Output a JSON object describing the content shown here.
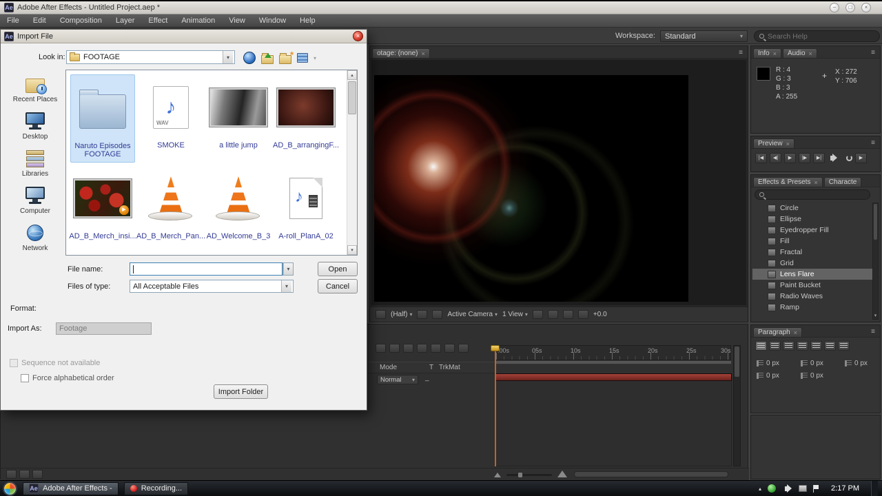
{
  "icons": {
    "close": "×",
    "dropdown": "▾",
    "up_arrow": "▴",
    "down_arrow": "▾",
    "menu": "≡",
    "minimize": "–",
    "maximize": "□",
    "first_frame": "|◀",
    "prev_frame": "◀|",
    "play": "▶",
    "next_frame": "|▶",
    "last_frame": "▶|",
    "crosshair": "+"
  },
  "titlebar": {
    "app_icon": "Ae",
    "title": "Adobe After Effects - Untitled Project.aep *"
  },
  "menubar": {
    "items": [
      "File",
      "Edit",
      "Composition",
      "Layer",
      "Effect",
      "Animation",
      "View",
      "Window",
      "Help"
    ]
  },
  "toolbar": {
    "workspace_label": "Workspace:",
    "workspace_value": "Standard",
    "search_placeholder": "Search Help"
  },
  "dialog": {
    "app_icon": "Ae",
    "title": "Import File",
    "look_in_label": "Look in:",
    "look_in_value": "FOOTAGE",
    "places": [
      {
        "label": "Recent Places"
      },
      {
        "label": "Desktop"
      },
      {
        "label": "Libraries"
      },
      {
        "label": "Computer"
      },
      {
        "label": "Network"
      }
    ],
    "files": [
      {
        "name": "Naruto Episodes FOOTAGE"
      },
      {
        "name": "SMOKE"
      },
      {
        "name": "a little jump"
      },
      {
        "name": "AD_B_arrangingF..."
      },
      {
        "name": "AD_B_Merch_insi..."
      },
      {
        "name": "AD_B_Merch_Pan..."
      },
      {
        "name": "AD_Welcome_B_3"
      },
      {
        "name": "A-roll_PlanA_02"
      }
    ],
    "wav_label": "WAV",
    "file_name_label": "File name:",
    "file_name_value": "",
    "files_of_type_label": "Files of type:",
    "files_of_type_value": "All Acceptable Files",
    "open_button": "Open",
    "cancel_button": "Cancel",
    "format_label": "Format:",
    "import_as_label": "Import As:",
    "import_as_value": "Footage",
    "sequence_checkbox_label": "Sequence not available",
    "alphabetical_checkbox_label": "Force alphabetical order",
    "import_folder_button": "Import Folder"
  },
  "comp": {
    "tab": "otage: (none)",
    "magnification": "(Half)",
    "camera": "Active Camera",
    "view_layout": "1 View",
    "exposure": "+0.0"
  },
  "info": {
    "tab_info": "Info",
    "tab_audio": "Audio",
    "r": "R : 4",
    "g": "G : 3",
    "b": "B : 3",
    "a": "A : 255",
    "x": "X : 272",
    "y": "Y : 706"
  },
  "preview": {
    "tab": "Preview"
  },
  "effects": {
    "tab": "Effects & Presets",
    "tab2": "Characte",
    "items": [
      {
        "label": "Circle"
      },
      {
        "label": "Ellipse"
      },
      {
        "label": "Eyedropper Fill"
      },
      {
        "label": "Fill"
      },
      {
        "label": "Fractal"
      },
      {
        "label": "Grid"
      },
      {
        "label": "Lens Flare"
      },
      {
        "label": "Paint Bucket"
      },
      {
        "label": "Radio Waves"
      },
      {
        "label": "Ramp"
      }
    ]
  },
  "paragraph": {
    "tab": "Paragraph",
    "fields": [
      {
        "value": "0 px"
      },
      {
        "value": "0 px"
      },
      {
        "value": "0 px"
      },
      {
        "value": "0 px"
      },
      {
        "value": "0 px"
      }
    ]
  },
  "timeline": {
    "mode_header": "Mode",
    "t_header": "T",
    "trkmat_header": "TrkMat",
    "blend_mode": "Normal",
    "trkmat_value": "_",
    "ruler": [
      ":00s",
      "05s",
      "10s",
      "15s",
      "20s",
      "25s",
      "30s"
    ]
  },
  "taskbar": {
    "app1_icon": "Ae",
    "app1": "Adobe After Effects -",
    "app2": "Recording...",
    "clock": "2:17 PM"
  }
}
